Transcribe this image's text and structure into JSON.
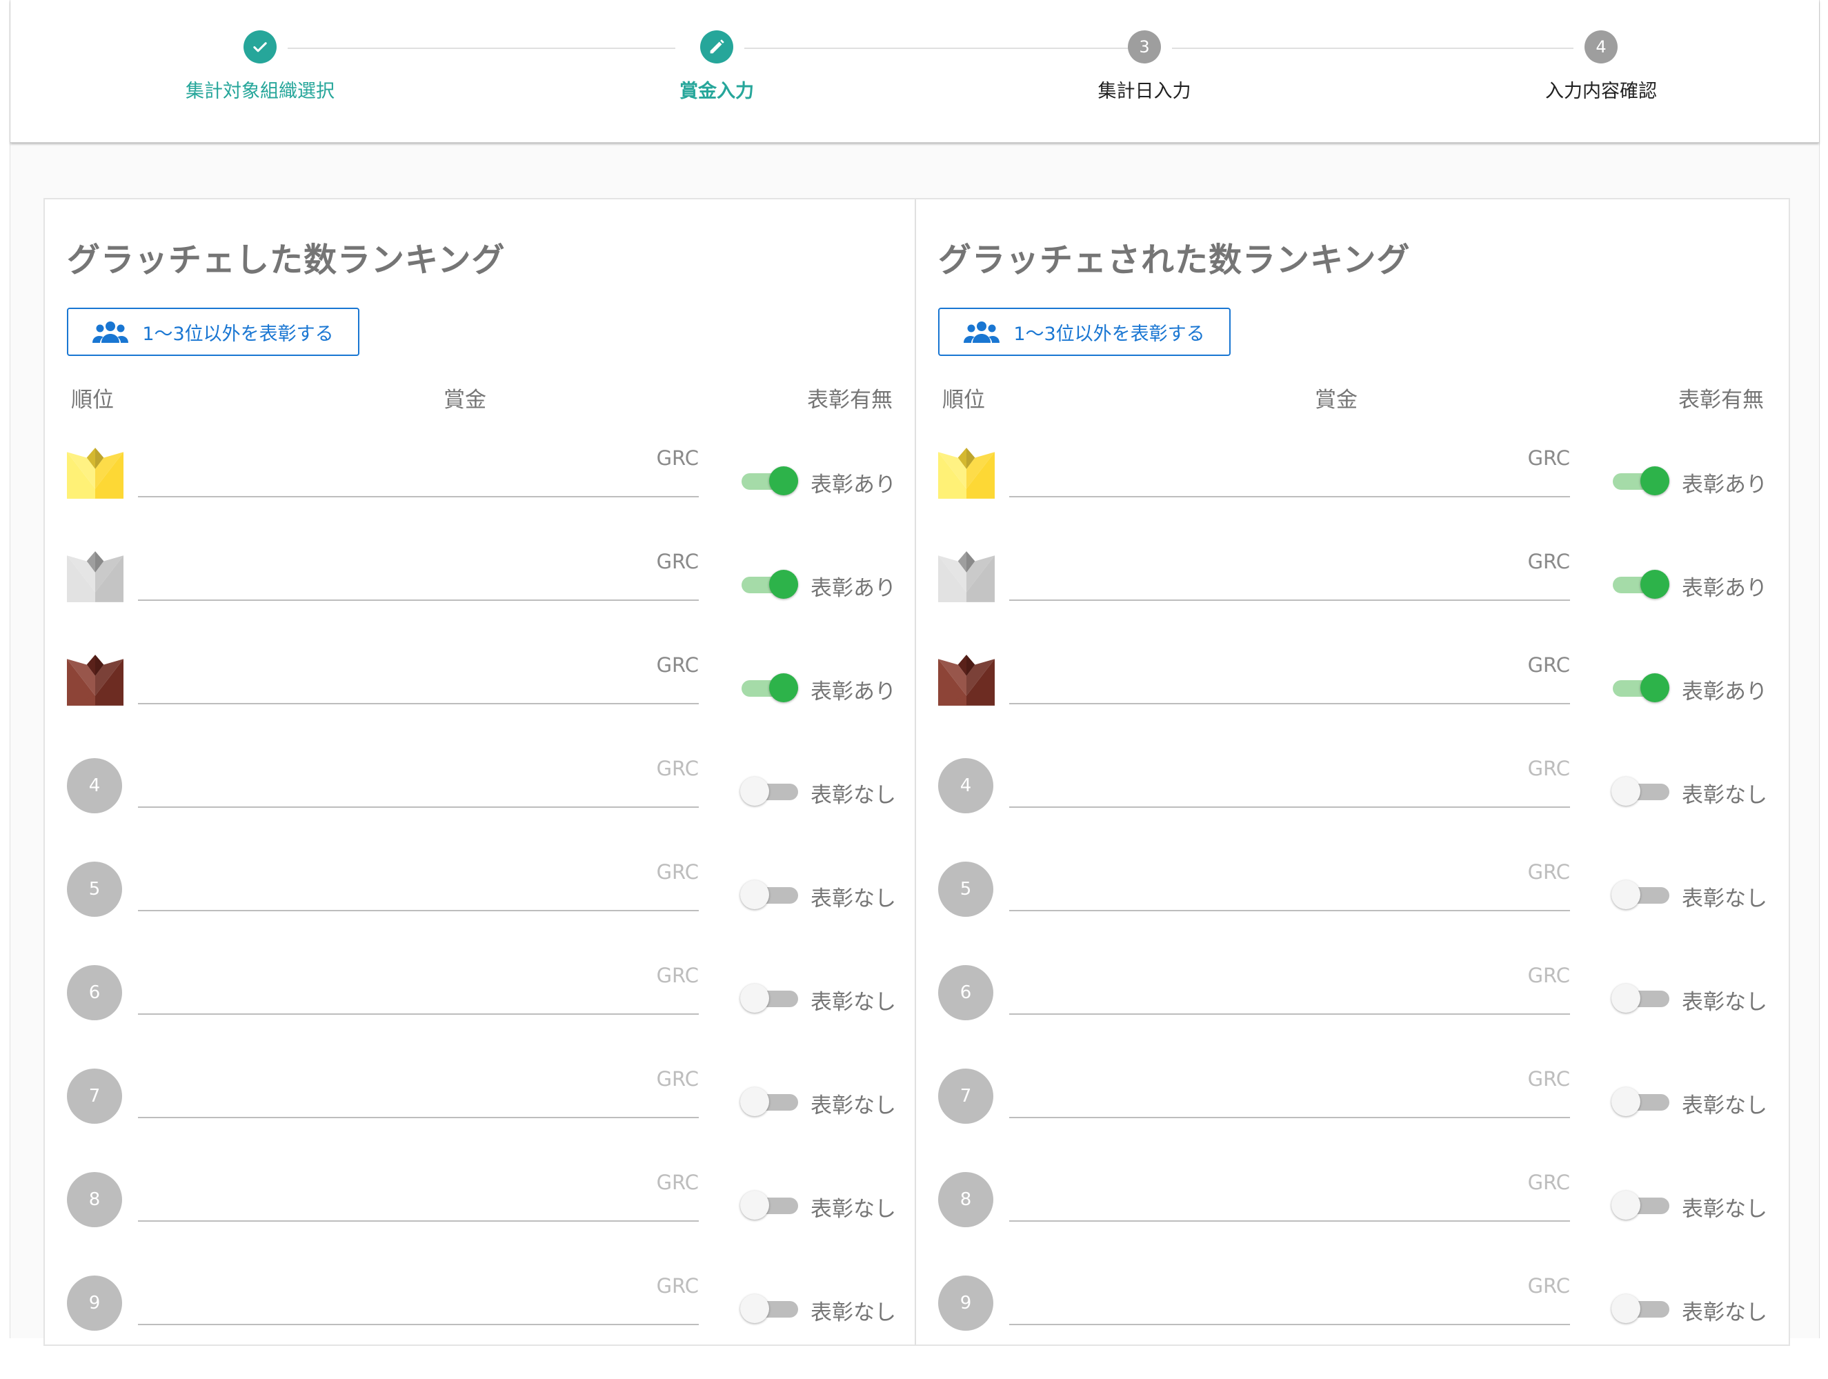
{
  "stepper": {
    "steps": [
      {
        "label": "集計対象組織選択",
        "number": "",
        "state": "done"
      },
      {
        "label": "賞金入力",
        "number": "",
        "state": "editing"
      },
      {
        "label": "集計日入力",
        "number": "3",
        "state": "pending"
      },
      {
        "label": "入力内容確認",
        "number": "4",
        "state": "pending"
      }
    ]
  },
  "colors": {
    "accent": "#26a69a",
    "primary": "#1976d2",
    "toggle_on": "#2db34a",
    "gold": "#fdd835",
    "silver": "#d6d6d6",
    "bronze": "#8d4437"
  },
  "panels": [
    {
      "title": "グラッチェした数ランキング",
      "award_button": "1〜3位以外を表彰する",
      "headers": {
        "rank": "順位",
        "prize": "賞金",
        "award": "表彰有無"
      },
      "rows": [
        {
          "rank": "1",
          "medal": "gold",
          "unit": "GRC",
          "prize": "",
          "award_on": true,
          "award_label": "表彰あり"
        },
        {
          "rank": "2",
          "medal": "silver",
          "unit": "GRC",
          "prize": "",
          "award_on": true,
          "award_label": "表彰あり"
        },
        {
          "rank": "3",
          "medal": "bronze",
          "unit": "GRC",
          "prize": "",
          "award_on": true,
          "award_label": "表彰あり"
        },
        {
          "rank": "4",
          "medal": "",
          "unit": "GRC",
          "prize": "",
          "award_on": false,
          "award_label": "表彰なし"
        },
        {
          "rank": "5",
          "medal": "",
          "unit": "GRC",
          "prize": "",
          "award_on": false,
          "award_label": "表彰なし"
        },
        {
          "rank": "6",
          "medal": "",
          "unit": "GRC",
          "prize": "",
          "award_on": false,
          "award_label": "表彰なし"
        },
        {
          "rank": "7",
          "medal": "",
          "unit": "GRC",
          "prize": "",
          "award_on": false,
          "award_label": "表彰なし"
        },
        {
          "rank": "8",
          "medal": "",
          "unit": "GRC",
          "prize": "",
          "award_on": false,
          "award_label": "表彰なし"
        },
        {
          "rank": "9",
          "medal": "",
          "unit": "GRC",
          "prize": "",
          "award_on": false,
          "award_label": "表彰なし"
        }
      ]
    },
    {
      "title": "グラッチェされた数ランキング",
      "award_button": "1〜3位以外を表彰する",
      "headers": {
        "rank": "順位",
        "prize": "賞金",
        "award": "表彰有無"
      },
      "rows": [
        {
          "rank": "1",
          "medal": "gold",
          "unit": "GRC",
          "prize": "",
          "award_on": true,
          "award_label": "表彰あり"
        },
        {
          "rank": "2",
          "medal": "silver",
          "unit": "GRC",
          "prize": "",
          "award_on": true,
          "award_label": "表彰あり"
        },
        {
          "rank": "3",
          "medal": "bronze",
          "unit": "GRC",
          "prize": "",
          "award_on": true,
          "award_label": "表彰あり"
        },
        {
          "rank": "4",
          "medal": "",
          "unit": "GRC",
          "prize": "",
          "award_on": false,
          "award_label": "表彰なし"
        },
        {
          "rank": "5",
          "medal": "",
          "unit": "GRC",
          "prize": "",
          "award_on": false,
          "award_label": "表彰なし"
        },
        {
          "rank": "6",
          "medal": "",
          "unit": "GRC",
          "prize": "",
          "award_on": false,
          "award_label": "表彰なし"
        },
        {
          "rank": "7",
          "medal": "",
          "unit": "GRC",
          "prize": "",
          "award_on": false,
          "award_label": "表彰なし"
        },
        {
          "rank": "8",
          "medal": "",
          "unit": "GRC",
          "prize": "",
          "award_on": false,
          "award_label": "表彰なし"
        },
        {
          "rank": "9",
          "medal": "",
          "unit": "GRC",
          "prize": "",
          "award_on": false,
          "award_label": "表彰なし"
        }
      ]
    }
  ]
}
